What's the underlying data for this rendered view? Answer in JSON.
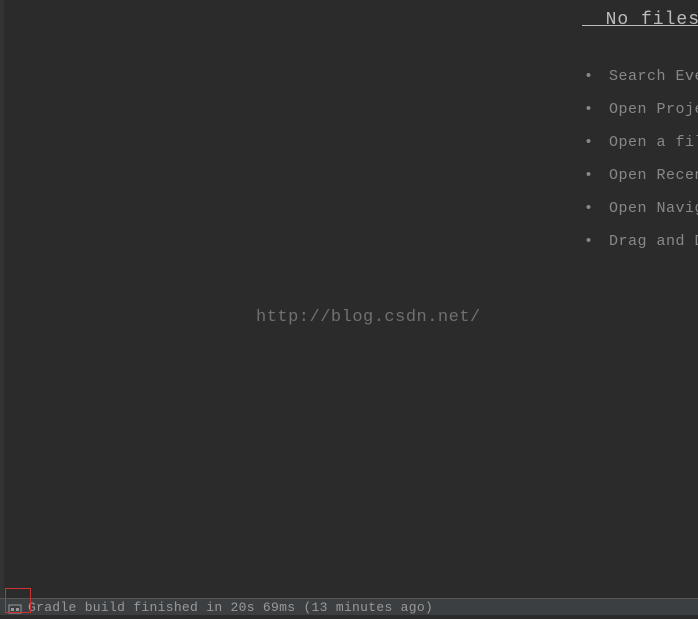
{
  "welcome": {
    "title": "  No files",
    "items": [
      "Search Ever",
      "Open Proje",
      "Open a file",
      "Open Recent",
      "Open Naviga",
      "Drag and Dr"
    ]
  },
  "watermark": {
    "url": "http://blog.csdn.net/"
  },
  "statusBar": {
    "message": "Gradle build finished in 20s 69ms (13 minutes ago)"
  }
}
